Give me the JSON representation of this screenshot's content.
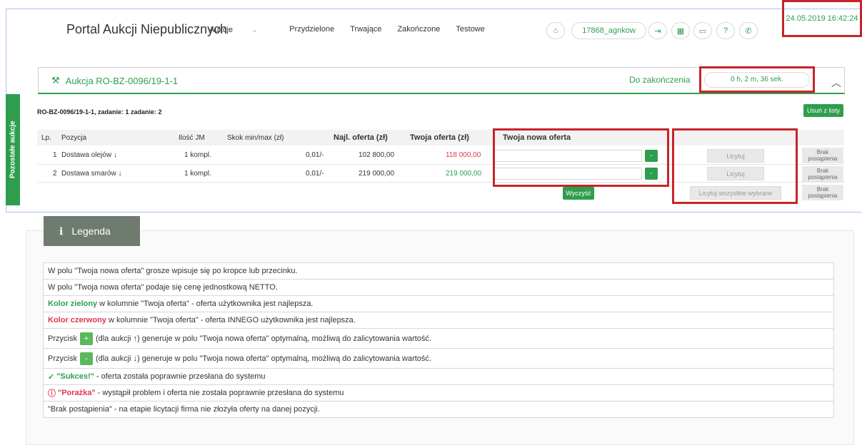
{
  "nav": {
    "brand": "Portal Aukcji Niepublicznych",
    "menu": [
      "Aukcje",
      "Przydzielone",
      "Trwające",
      "Zakończone",
      "Testowe"
    ],
    "user": "17868_agnkow",
    "datetime": "24.05.2019 16:42:24"
  },
  "sidebar_tab": "Pozostałe aukcje",
  "auction": {
    "title": "Aukcja RO-BZ-0096/19-1-1",
    "deadline_label": "Do zakończenia",
    "timer": "0 h, 2 m, 36 sek.",
    "subtitle": "RO-BZ-0096/19-1-1, zadanie: 1 zadanie: 2",
    "remove_label": "Usuń z listy"
  },
  "table": {
    "headers": {
      "lp": "Lp.",
      "pozycja": "Pozycja",
      "ilosc": "Ilość JM",
      "skok": "Skok min/max (zł)",
      "najl": "Najl. oferta (zł)",
      "twoja": "Twoja oferta (zł)",
      "nowa": "Twoja nowa oferta"
    },
    "rows": [
      {
        "lp": "1",
        "name": "Dostawa olejów ↓",
        "qty": "1 kompl.",
        "skok": "0,01/-",
        "najl": "102 800,00",
        "twoja": "118 000,00",
        "twoja_color": "#e0354b",
        "lic": "Licytuj",
        "brak": "Brak postąpienia"
      },
      {
        "lp": "2",
        "name": "Dostawa smarów ↓",
        "qty": "1 kompl.",
        "skok": "0,01/-",
        "najl": "219 000,00",
        "twoja": "219 000,00",
        "twoja_color": "#2e9e4e",
        "lic": "Licytuj",
        "brak": "Brak postąpienia"
      }
    ],
    "clear_label": "Wyczyść",
    "bid_all_label": "Licytuj wszystkie wybrane",
    "brak3": "Brak postąpienia",
    "minus": "-"
  },
  "legend": {
    "title": "Legenda",
    "l1": "W polu \"Twoja nowa oferta\" grosze wpisuje się po kropce lub przecinku.",
    "l2": "W polu \"Twoja nowa oferta\" podaje się cenę jednostkową NETTO.",
    "l3a": "Kolor zielony",
    "l3b": " w kolumnie \"Twoja oferta\" - oferta użytkownika jest najlepsza.",
    "l4a": "Kolor czerwony",
    "l4b": " w kolumnie \"Twoja oferta\" - oferta INNEGO użytkownika jest najlepsza.",
    "l5a": "Przycisk",
    "l5btn": "+",
    "l5b": "(dla aukcji ↑) generuje w polu \"Twoja nowa oferta\" optymalną, możliwą do zalicytowania wartość.",
    "l6a": "Przycisk",
    "l6btn": "-",
    "l6b": "(dla aukcji ↓) generuje w polu \"Twoja nowa oferta\" optymalną, możliwą do zalicytowania wartość.",
    "l7a": "\"Sukces!\"",
    "l7b": " - oferta została poprawnie przesłana do systemu",
    "l8a": "\"Porażka\"",
    "l8b": " - wystąpił problem i oferta nie została poprawnie przesłana do systemu",
    "l9": "\"Brak postąpienia\" - na etapie licytacji firma nie złożyła oferty na danej pozycji."
  }
}
